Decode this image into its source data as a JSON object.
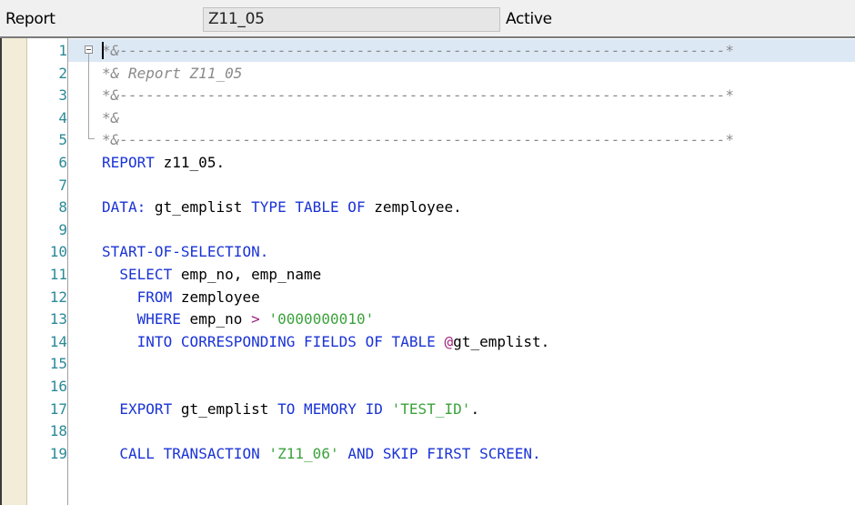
{
  "header": {
    "type_label": "Report",
    "program_name": "Z11_05",
    "status": "Active"
  },
  "editor": {
    "current_line": 1,
    "lines": [
      {
        "number": "1",
        "tokens": [
          {
            "t": "*&---------------------------------------------------------------------*",
            "c": "t-comment"
          }
        ]
      },
      {
        "number": "2",
        "tokens": [
          {
            "t": "*& Report Z11_05",
            "c": "t-comment"
          }
        ]
      },
      {
        "number": "3",
        "tokens": [
          {
            "t": "*&---------------------------------------------------------------------*",
            "c": "t-comment"
          }
        ]
      },
      {
        "number": "4",
        "tokens": [
          {
            "t": "*&",
            "c": "t-comment"
          }
        ]
      },
      {
        "number": "5",
        "tokens": [
          {
            "t": "*&---------------------------------------------------------------------*",
            "c": "t-comment"
          }
        ]
      },
      {
        "number": "6",
        "tokens": [
          {
            "t": "REPORT",
            "c": "t-keyword"
          },
          {
            "t": " z11_05.",
            "c": "t-plain"
          }
        ]
      },
      {
        "number": "7",
        "tokens": []
      },
      {
        "number": "8",
        "tokens": [
          {
            "t": "DATA:",
            "c": "t-keyword"
          },
          {
            "t": " gt_emplist ",
            "c": "t-plain"
          },
          {
            "t": "TYPE TABLE OF",
            "c": "t-keyword"
          },
          {
            "t": " zemployee.",
            "c": "t-plain"
          }
        ]
      },
      {
        "number": "9",
        "tokens": []
      },
      {
        "number": "10",
        "tokens": [
          {
            "t": "START-OF-SELECTION.",
            "c": "t-keyword"
          }
        ]
      },
      {
        "number": "11",
        "tokens": [
          {
            "t": "  ",
            "c": "t-plain"
          },
          {
            "t": "SELECT",
            "c": "t-keyword"
          },
          {
            "t": " emp_no, emp_name",
            "c": "t-plain"
          }
        ]
      },
      {
        "number": "12",
        "tokens": [
          {
            "t": "    ",
            "c": "t-plain"
          },
          {
            "t": "FROM",
            "c": "t-keyword"
          },
          {
            "t": " zemployee",
            "c": "t-plain"
          }
        ]
      },
      {
        "number": "13",
        "tokens": [
          {
            "t": "    ",
            "c": "t-plain"
          },
          {
            "t": "WHERE",
            "c": "t-keyword"
          },
          {
            "t": " emp_no ",
            "c": "t-plain"
          },
          {
            "t": ">",
            "c": "t-op"
          },
          {
            "t": " ",
            "c": "t-plain"
          },
          {
            "t": "'0000000010'",
            "c": "t-string"
          }
        ]
      },
      {
        "number": "14",
        "tokens": [
          {
            "t": "    ",
            "c": "t-plain"
          },
          {
            "t": "INTO CORRESPONDING FIELDS OF TABLE",
            "c": "t-keyword"
          },
          {
            "t": " ",
            "c": "t-plain"
          },
          {
            "t": "@",
            "c": "t-op"
          },
          {
            "t": "gt_emplist.",
            "c": "t-plain"
          }
        ]
      },
      {
        "number": "15",
        "tokens": []
      },
      {
        "number": "16",
        "tokens": []
      },
      {
        "number": "17",
        "tokens": [
          {
            "t": "  ",
            "c": "t-plain"
          },
          {
            "t": "EXPORT",
            "c": "t-keyword"
          },
          {
            "t": " gt_emplist ",
            "c": "t-plain"
          },
          {
            "t": "TO MEMORY ID",
            "c": "t-keyword"
          },
          {
            "t": " ",
            "c": "t-plain"
          },
          {
            "t": "'TEST_ID'",
            "c": "t-string"
          },
          {
            "t": ".",
            "c": "t-plain"
          }
        ]
      },
      {
        "number": "18",
        "tokens": []
      },
      {
        "number": "19",
        "tokens": [
          {
            "t": "  ",
            "c": "t-plain"
          },
          {
            "t": "CALL TRANSACTION",
            "c": "t-keyword"
          },
          {
            "t": " ",
            "c": "t-plain"
          },
          {
            "t": "'Z11_06'",
            "c": "t-string"
          },
          {
            "t": " ",
            "c": "t-plain"
          },
          {
            "t": "AND SKIP FIRST SCREEN.",
            "c": "t-keyword"
          }
        ]
      }
    ]
  }
}
